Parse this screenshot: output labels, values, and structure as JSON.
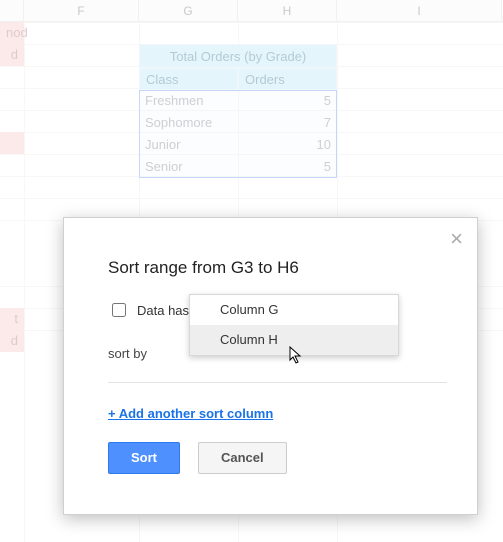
{
  "columns": {
    "f": "F",
    "g": "G",
    "h": "H",
    "i": "I"
  },
  "partial_labels": {
    "row1": "nod",
    "row2": "d",
    "row_t": "t",
    "row_d2": "d"
  },
  "table": {
    "title": "Total Orders (by Grade)",
    "headers": {
      "class": "Class",
      "orders": "Orders"
    },
    "rows": [
      {
        "class": "Freshmen",
        "orders": "5"
      },
      {
        "class": "Sophomore",
        "orders": "7"
      },
      {
        "class": "Junior",
        "orders": "10"
      },
      {
        "class": "Senior",
        "orders": "5"
      }
    ]
  },
  "dialog": {
    "title": "Sort range from G3 to H6",
    "checkbox_label": "Data has",
    "sort_by_label": "sort by",
    "add_link": "+ Add another sort column",
    "sort_button": "Sort",
    "cancel_button": "Cancel"
  },
  "dropdown": {
    "options": [
      "Column G",
      "Column H"
    ]
  }
}
